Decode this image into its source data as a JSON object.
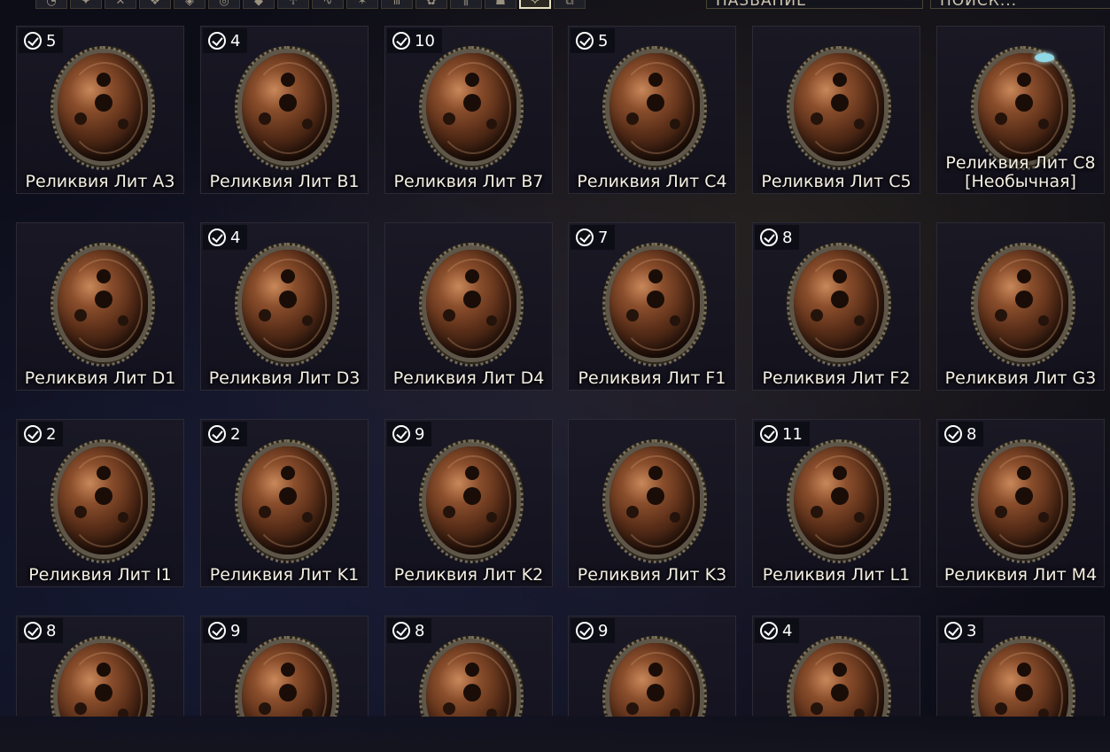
{
  "toolbar": {
    "filter_icons": [
      "warframe-icon",
      "primary-icon",
      "melee-icon",
      "sentinel-icon",
      "archwing-icon",
      "ring-icon",
      "shield-icon",
      "sword-icon",
      "necramech-icon",
      "fish-icon",
      "claw-icon",
      "gem-icon",
      "bars-icon",
      "mod-icon",
      "relic-icon",
      "tag-icon"
    ],
    "active_filter_index": 14,
    "sort_label": "НАЗВАНИЕ",
    "search_placeholder": "ПОИСК..."
  },
  "relics": [
    {
      "name": "Реликвия Лит A3",
      "count": "5",
      "owned": true,
      "gem": false
    },
    {
      "name": "Реликвия Лит B1",
      "count": "4",
      "owned": true,
      "gem": false
    },
    {
      "name": "Реликвия Лит B7",
      "count": "10",
      "owned": true,
      "gem": false
    },
    {
      "name": "Реликвия Лит C4",
      "count": "5",
      "owned": true,
      "gem": false
    },
    {
      "name": "Реликвия Лит C5",
      "count": "",
      "owned": false,
      "gem": false
    },
    {
      "name": "Реликвия Лит C8 [Необычная]",
      "count": "",
      "owned": false,
      "gem": true
    },
    {
      "name": "Реликвия Лит D1",
      "count": "",
      "owned": false,
      "gem": false
    },
    {
      "name": "Реликвия Лит D3",
      "count": "4",
      "owned": true,
      "gem": false
    },
    {
      "name": "Реликвия Лит D4",
      "count": "",
      "owned": false,
      "gem": false
    },
    {
      "name": "Реликвия Лит F1",
      "count": "7",
      "owned": true,
      "gem": false
    },
    {
      "name": "Реликвия Лит F2",
      "count": "8",
      "owned": true,
      "gem": false
    },
    {
      "name": "Реликвия Лит G3",
      "count": "",
      "owned": false,
      "gem": false
    },
    {
      "name": "Реликвия Лит I1",
      "count": "2",
      "owned": true,
      "gem": false
    },
    {
      "name": "Реликвия Лит K1",
      "count": "2",
      "owned": true,
      "gem": false
    },
    {
      "name": "Реликвия Лит K2",
      "count": "9",
      "owned": true,
      "gem": false
    },
    {
      "name": "Реликвия Лит K3",
      "count": "",
      "owned": false,
      "gem": false
    },
    {
      "name": "Реликвия Лит L1",
      "count": "11",
      "owned": true,
      "gem": false
    },
    {
      "name": "Реликвия Лит M4",
      "count": "8",
      "owned": true,
      "gem": false
    },
    {
      "name": "",
      "count": "8",
      "owned": true,
      "gem": false
    },
    {
      "name": "",
      "count": "9",
      "owned": true,
      "gem": false
    },
    {
      "name": "",
      "count": "8",
      "owned": true,
      "gem": false
    },
    {
      "name": "",
      "count": "9",
      "owned": true,
      "gem": false
    },
    {
      "name": "",
      "count": "4",
      "owned": true,
      "gem": false
    },
    {
      "name": "",
      "count": "3",
      "owned": true,
      "gem": false
    }
  ]
}
